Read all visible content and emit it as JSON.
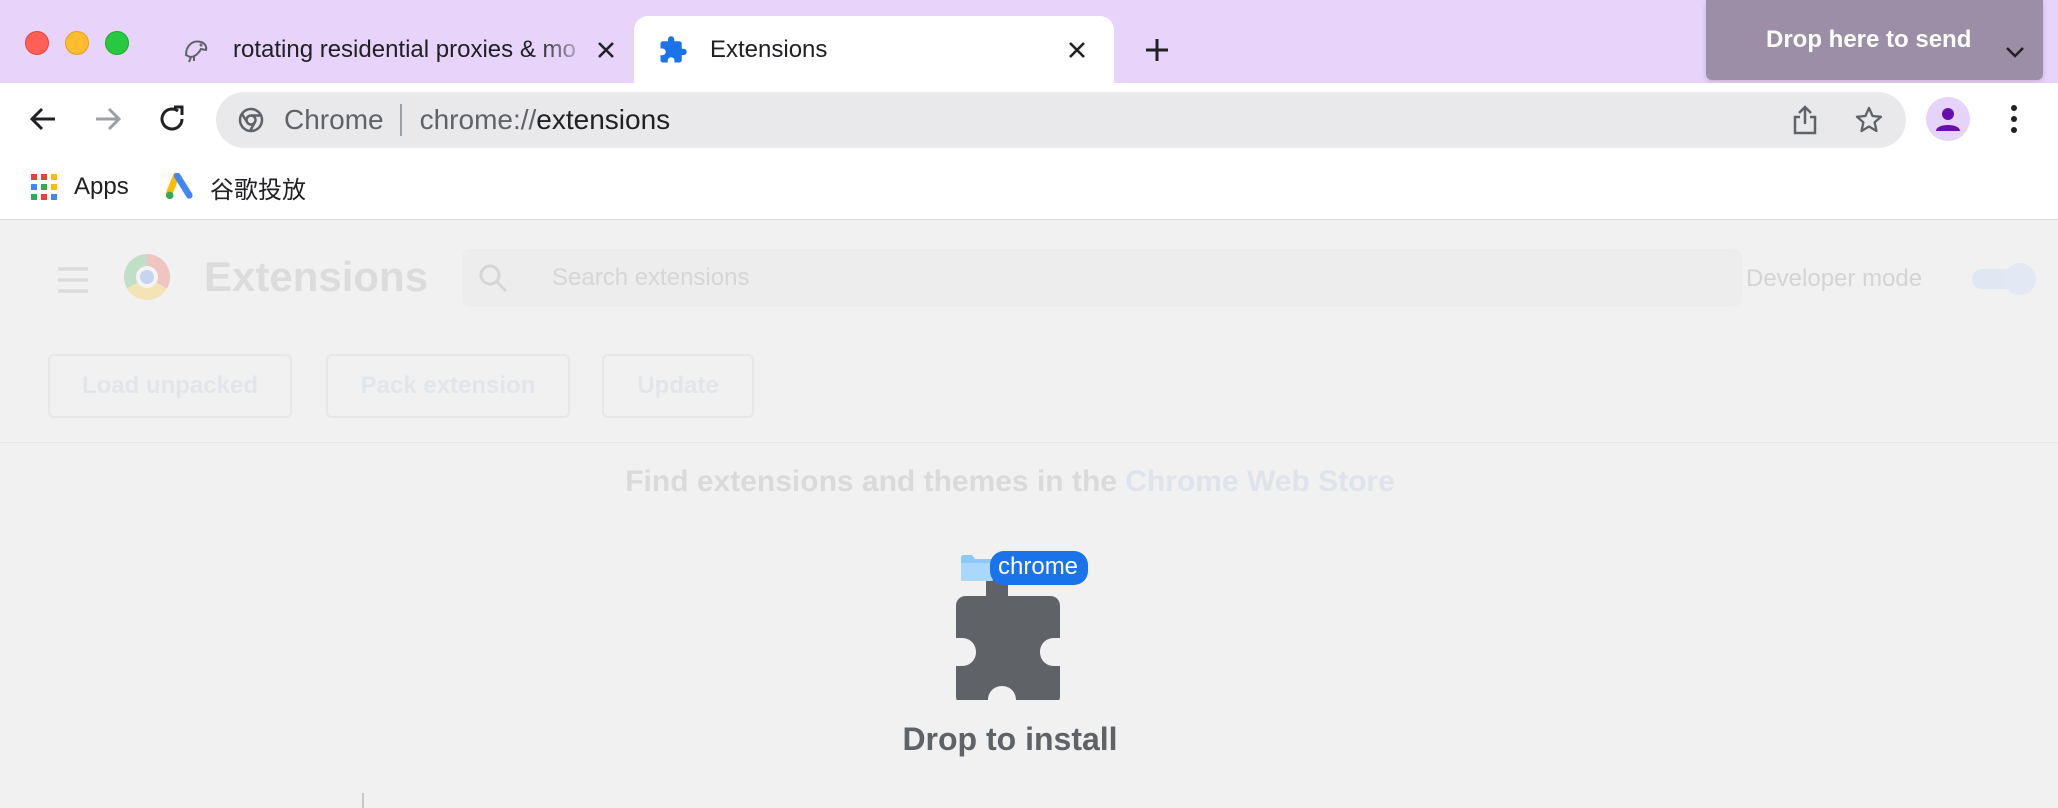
{
  "tabs": [
    {
      "title": "rotating residential proxies & mo",
      "active": false,
      "favicon": "bird-logo-icon"
    },
    {
      "title": "Extensions",
      "active": true,
      "favicon": "puzzle-icon"
    }
  ],
  "drop_overlay": {
    "label": "Drop here to send"
  },
  "omnibox": {
    "chip": "Chrome",
    "url_scheme": "chrome://",
    "url_path": "extensions"
  },
  "bookmarks": [
    {
      "label": "Apps",
      "icon": "apps-grid-icon"
    },
    {
      "label": "谷歌投放",
      "icon": "google-ads-icon"
    }
  ],
  "extensions_page": {
    "title": "Extensions",
    "search_placeholder": "Search extensions",
    "developer_mode_label": "Developer mode",
    "developer_mode_on": true,
    "actions": [
      "Load unpacked",
      "Pack extension",
      "Update"
    ],
    "store_text": "Find extensions and themes in the",
    "store_link": "Chrome Web Store",
    "dragged_item": "chrome",
    "drop_label": "Drop to install"
  },
  "colors": {
    "tabstrip_bg": "#e8d3fb",
    "drop_overlay_bg": "#9c8ea6",
    "accent_blue": "#1a73e8",
    "avatar_purple": "#6a0dad"
  }
}
